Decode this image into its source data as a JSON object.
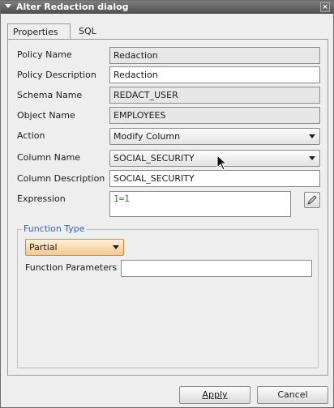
{
  "dialog": {
    "title": "Alter Redaction dialog",
    "close_glyph": "×"
  },
  "tabs": [
    {
      "label": "Properties",
      "active": true
    },
    {
      "label": "SQL",
      "active": false
    }
  ],
  "form": {
    "policy_name": {
      "label": "Policy Name",
      "value": "Redaction"
    },
    "policy_description": {
      "label": "Policy Description",
      "value": "Redaction"
    },
    "schema_name": {
      "label": "Schema Name",
      "value": "REDACT_USER"
    },
    "object_name": {
      "label": "Object Name",
      "value": "EMPLOYEES"
    },
    "action": {
      "label": "Action",
      "value": "Modify Column"
    },
    "column_name": {
      "label": "Column Name",
      "value": "SOCIAL_SECURITY"
    },
    "column_description": {
      "label": "Column Description",
      "value": "SOCIAL_SECURITY"
    },
    "expression": {
      "label": "Expression",
      "value": "1=1"
    }
  },
  "function_type": {
    "title": "Function Type",
    "selected": "Partial",
    "parameters_label": "Function Parameters",
    "parameters_value": ""
  },
  "buttons": {
    "apply": "Apply",
    "cancel": "Cancel"
  },
  "icons": {
    "edit": "pencil-icon",
    "close": "close-icon",
    "collapse": "triangle-down-icon",
    "dropdown": "chevron-down-icon"
  },
  "colors": {
    "title_bar": "#5e5e5e",
    "group_title": "#3b63a8",
    "expression_text": "#2e7d32",
    "combo_highlight": "#f3c98e"
  }
}
